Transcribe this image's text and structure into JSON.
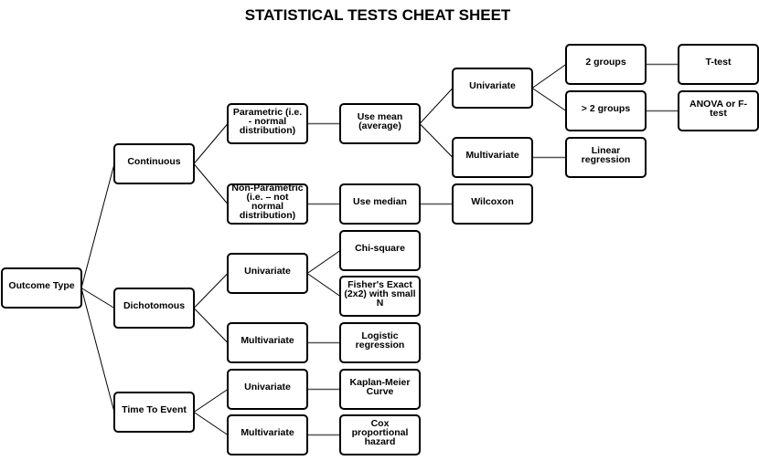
{
  "title": "STATISTICAL TESTS CHEAT SHEET",
  "nodes": [
    {
      "id": "outcome",
      "label": "Outcome Type",
      "parent": null
    },
    {
      "id": "continuous",
      "label": "Continuous",
      "parent": "outcome"
    },
    {
      "id": "dichotomous",
      "label": "Dichotomous",
      "parent": "outcome"
    },
    {
      "id": "tte",
      "label": "Time To Event",
      "parent": "outcome"
    },
    {
      "id": "parametric",
      "label": "Parametric (i.e. - normal distribution)",
      "parent": "continuous"
    },
    {
      "id": "nonparametric",
      "label": "Non-Parametric (i.e. – not normal distribution)",
      "parent": "continuous"
    },
    {
      "id": "usemean",
      "label": "Use mean (average)",
      "parent": "parametric"
    },
    {
      "id": "usemedian",
      "label": "Use median",
      "parent": "nonparametric"
    },
    {
      "id": "cont_univariate",
      "label": "Univariate",
      "parent": "usemean"
    },
    {
      "id": "cont_multivariate",
      "label": "Multivariate",
      "parent": "usemean"
    },
    {
      "id": "wilcoxon",
      "label": "Wilcoxon",
      "parent": "usemedian"
    },
    {
      "id": "twogroups",
      "label": "2 groups",
      "parent": "cont_univariate"
    },
    {
      "id": "moregroups",
      "label": "> 2 groups",
      "parent": "cont_univariate"
    },
    {
      "id": "linear",
      "label": "Linear regression",
      "parent": "cont_multivariate"
    },
    {
      "id": "ttest",
      "label": "T-test",
      "parent": "twogroups"
    },
    {
      "id": "anova",
      "label": "ANOVA or F-test",
      "parent": "moregroups"
    },
    {
      "id": "dich_univariate",
      "label": "Univariate",
      "parent": "dichotomous"
    },
    {
      "id": "dich_multivariate",
      "label": "Multivariate",
      "parent": "dichotomous"
    },
    {
      "id": "chisquare",
      "label": "Chi-square",
      "parent": "dich_univariate"
    },
    {
      "id": "fisher",
      "label": "Fisher's Exact (2x2) with small N",
      "parent": "dich_univariate"
    },
    {
      "id": "logistic",
      "label": "Logistic regression",
      "parent": "dich_multivariate"
    },
    {
      "id": "tte_univariate",
      "label": "Univariate",
      "parent": "tte"
    },
    {
      "id": "tte_multivariate",
      "label": "Multivariate",
      "parent": "tte"
    },
    {
      "id": "kaplan",
      "label": "Kaplan-Meier Curve",
      "parent": "tte_univariate"
    },
    {
      "id": "cox",
      "label": "Cox proportional hazard",
      "parent": "tte_multivariate"
    }
  ]
}
